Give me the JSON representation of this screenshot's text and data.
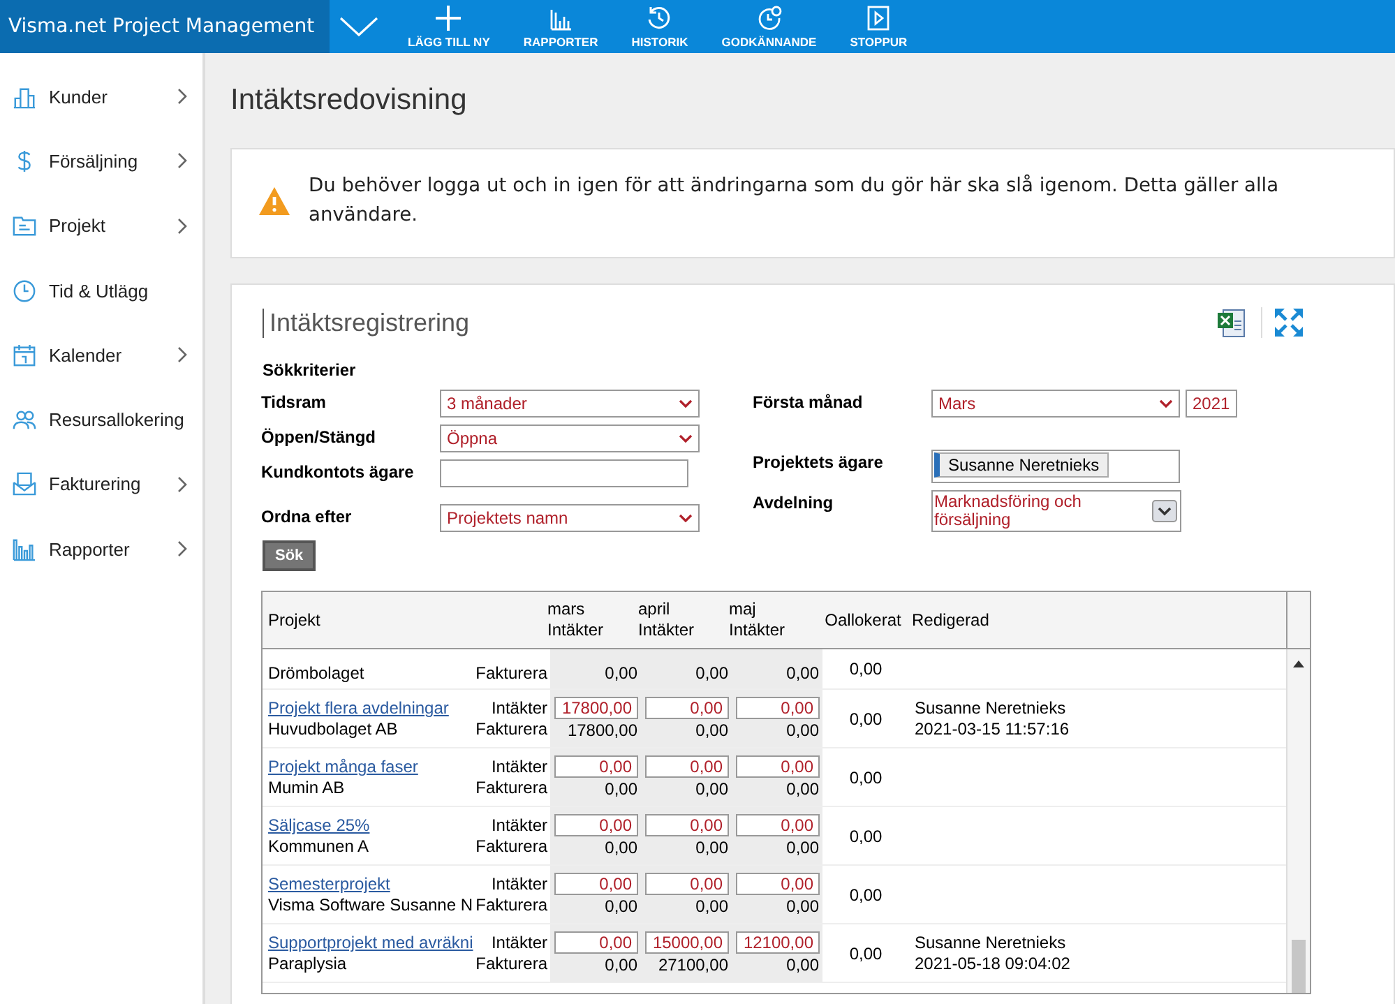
{
  "app": {
    "title": "Visma.net Project Management"
  },
  "toolbar": [
    {
      "label": "LÄGG TILL NY"
    },
    {
      "label": "RAPPORTER"
    },
    {
      "label": "HISTORIK"
    },
    {
      "label": "GODKÄNNANDE"
    },
    {
      "label": "STOPPUR"
    }
  ],
  "sidebar": {
    "items": [
      {
        "label": "Kunder",
        "expandable": true
      },
      {
        "label": "Försäljning",
        "expandable": true
      },
      {
        "label": "Projekt",
        "expandable": true
      },
      {
        "label": "Tid & Utlägg",
        "expandable": false
      },
      {
        "label": "Kalender",
        "expandable": true
      },
      {
        "label": "Resursallokering",
        "expandable": false
      },
      {
        "label": "Fakturering",
        "expandable": true
      },
      {
        "label": "Rapporter",
        "expandable": true
      }
    ]
  },
  "page_title": "Intäktsredovisning",
  "warning": {
    "text": "Du behöver logga ut och in igen för att ändringarna som du gör här ska slå igenom. Detta gäller alla användare."
  },
  "panel": {
    "title": "Intäktsregistrering",
    "criteria_heading": "Sökkriterier",
    "left_fields": [
      {
        "label": "Tidsram",
        "kind": "select",
        "value": "3 månader"
      },
      {
        "label": "Öppen/Stängd",
        "kind": "select",
        "value": "Öppna"
      },
      {
        "label": "Kundkontots ägare",
        "kind": "text"
      },
      {
        "label": "Ordna efter",
        "kind": "select",
        "value": "Projektets namn"
      }
    ],
    "right_fields": [
      {
        "label": "Första månad",
        "kind": "select",
        "value": "Mars",
        "extra": "2021"
      },
      {
        "label": "Projektets ägare",
        "kind": "tag",
        "value": "Susanne Neretnieks"
      },
      {
        "label": "Avdelning",
        "kind": "multiselect",
        "value": "Marknadsföring och försäljning"
      }
    ],
    "search_button": "Sök"
  },
  "table": {
    "columns": [
      {
        "label": "Projekt"
      },
      {
        "month": "mars",
        "label": "Intäkter"
      },
      {
        "month": "april",
        "label": "Intäkter"
      },
      {
        "month": "maj",
        "label": "Intäkter"
      },
      {
        "label": "Oallokerat"
      },
      {
        "label": "Redigerad"
      }
    ],
    "rows": [
      {
        "customer": "Drömbolaget",
        "invoiced_label": "Fakturera",
        "invoiced": [
          "0,00",
          "0,00",
          "0,00"
        ],
        "unallocated": "0,00"
      },
      {
        "project": "Projekt flera avdelningar",
        "customer": "Huvudbolaget AB",
        "income_label": "Intäkter",
        "invoiced_label": "Fakturera",
        "income": [
          "17800,00",
          "0,00",
          "0,00"
        ],
        "invoiced": [
          "17800,00",
          "0,00",
          "0,00"
        ],
        "unallocated": "0,00",
        "edited_by": "Susanne Neretnieks",
        "edited_at": "2021-03-15 11:57:16"
      },
      {
        "project": "Projekt många faser",
        "customer": "Mumin AB",
        "income_label": "Intäkter",
        "invoiced_label": "Fakturera",
        "income": [
          "0,00",
          "0,00",
          "0,00"
        ],
        "invoiced": [
          "0,00",
          "0,00",
          "0,00"
        ],
        "unallocated": "0,00"
      },
      {
        "project": "Säljcase 25%",
        "customer": "Kommunen A",
        "income_label": "Intäkter",
        "invoiced_label": "Fakturera",
        "income": [
          "0,00",
          "0,00",
          "0,00"
        ],
        "invoiced": [
          "0,00",
          "0,00",
          "0,00"
        ],
        "unallocated": "0,00"
      },
      {
        "project": "Semesterprojekt",
        "customer": "Visma Software Susanne N",
        "income_label": "Intäkter",
        "invoiced_label": "Fakturera",
        "income": [
          "0,00",
          "0,00",
          "0,00"
        ],
        "invoiced": [
          "0,00",
          "0,00",
          "0,00"
        ],
        "unallocated": "0,00"
      },
      {
        "project": "Supportprojekt med avräkni",
        "customer": "Paraplysia",
        "income_label": "Intäkter",
        "invoiced_label": "Fakturera",
        "income": [
          "0,00",
          "15000,00",
          "12100,00"
        ],
        "invoiced": [
          "0,00",
          "27100,00",
          "0,00"
        ],
        "unallocated": "0,00",
        "edited_by": "Susanne Neretnieks",
        "edited_at": "2021-05-18 09:04:02"
      }
    ]
  }
}
